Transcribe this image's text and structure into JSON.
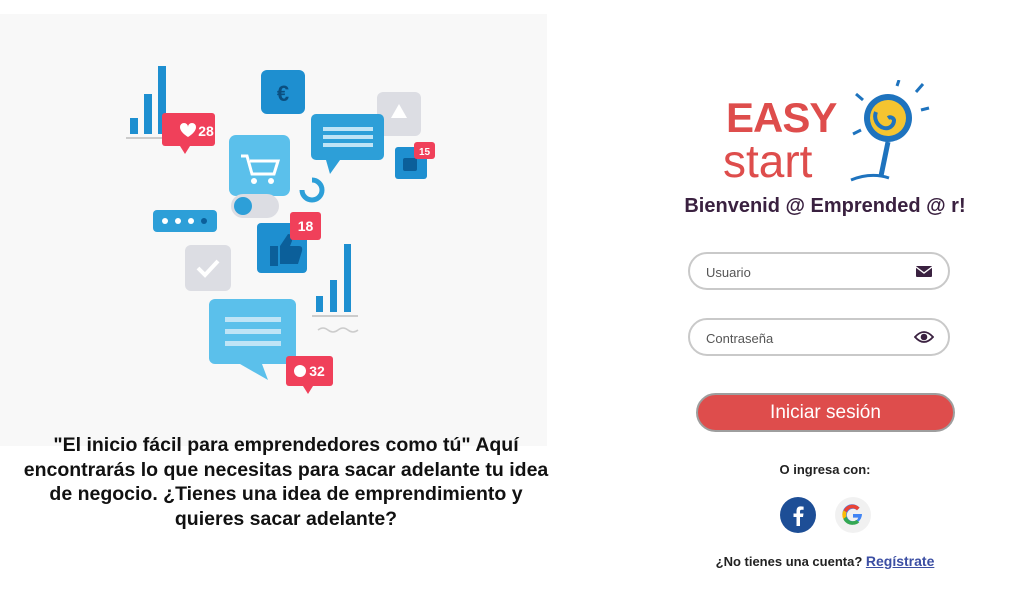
{
  "left": {
    "tagline": "\"El inicio fácil para emprendedores como tú\" Aquí encontrarás lo que necesitas para sacar adelante tu idea de negocio. ¿Tienes una idea de emprendimiento y quieres sacar adelante?",
    "illustration": {
      "likes_count": "28",
      "thumbs_count": "18",
      "small_badge_count": "15",
      "comments_count": "32"
    }
  },
  "logo": {
    "word1": "EASY",
    "word2": "start"
  },
  "login": {
    "welcome": "Bienvenid @ Emprended @ r!",
    "username_placeholder": "Usuario",
    "password_placeholder": "Contraseña",
    "submit_label": "Iniciar sesión",
    "or_label": "O ingresa con:",
    "no_account_text": "¿No tienes una cuenta?",
    "signup_link": "Regístrate"
  },
  "icons": {
    "username": "envelope-icon",
    "password": "eye-icon",
    "social": [
      "facebook-icon",
      "google-icon"
    ]
  },
  "colors": {
    "brand_red": "#de4d4c",
    "brand_blue": "#1e73be",
    "brand_yellow": "#f4c430",
    "welcome_text": "#3a2140",
    "illustration_blue": "#2d9fd8",
    "badge_red": "#f0405a",
    "link": "#3b4ea3"
  }
}
